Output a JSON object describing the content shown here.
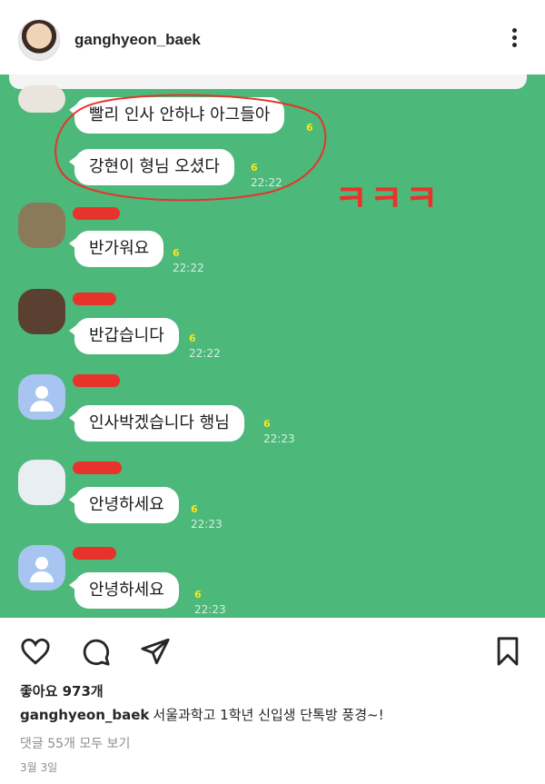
{
  "header": {
    "username": "ganghyeon_baek"
  },
  "chat": {
    "messages": [
      {
        "text": "빨리 인사 안하냐 아그들아",
        "unread": "6",
        "time": ""
      },
      {
        "text": "강현이 형님 오셨다",
        "unread": "6",
        "time": "22:22"
      },
      {
        "text": "반가워요",
        "unread": "6",
        "time": "22:22"
      },
      {
        "text": "반갑습니다",
        "unread": "6",
        "time": "22:22"
      },
      {
        "text": "인사박겠습니다 행님",
        "unread": "6",
        "time": "22:23"
      },
      {
        "text": "안녕하세요",
        "unread": "6",
        "time": "22:23"
      },
      {
        "text": "안녕하세요",
        "unread": "6",
        "time": "22:23"
      }
    ],
    "annotation": "ㅋㅋㅋ",
    "accent_colors": {
      "chat_bg": "#4cb87a",
      "annotation_red": "#e8332c"
    }
  },
  "post": {
    "likes": "좋아요 973개",
    "caption_user": "ganghyeon_baek",
    "caption_text": "서울과학고 1학년 신입생 단톡방 풍경~!",
    "comments": "댓글 55개 모두 보기",
    "date": "3월 3일"
  },
  "icons": [
    "heart-icon",
    "comment-icon",
    "share-icon",
    "bookmark-icon",
    "more-icon"
  ]
}
